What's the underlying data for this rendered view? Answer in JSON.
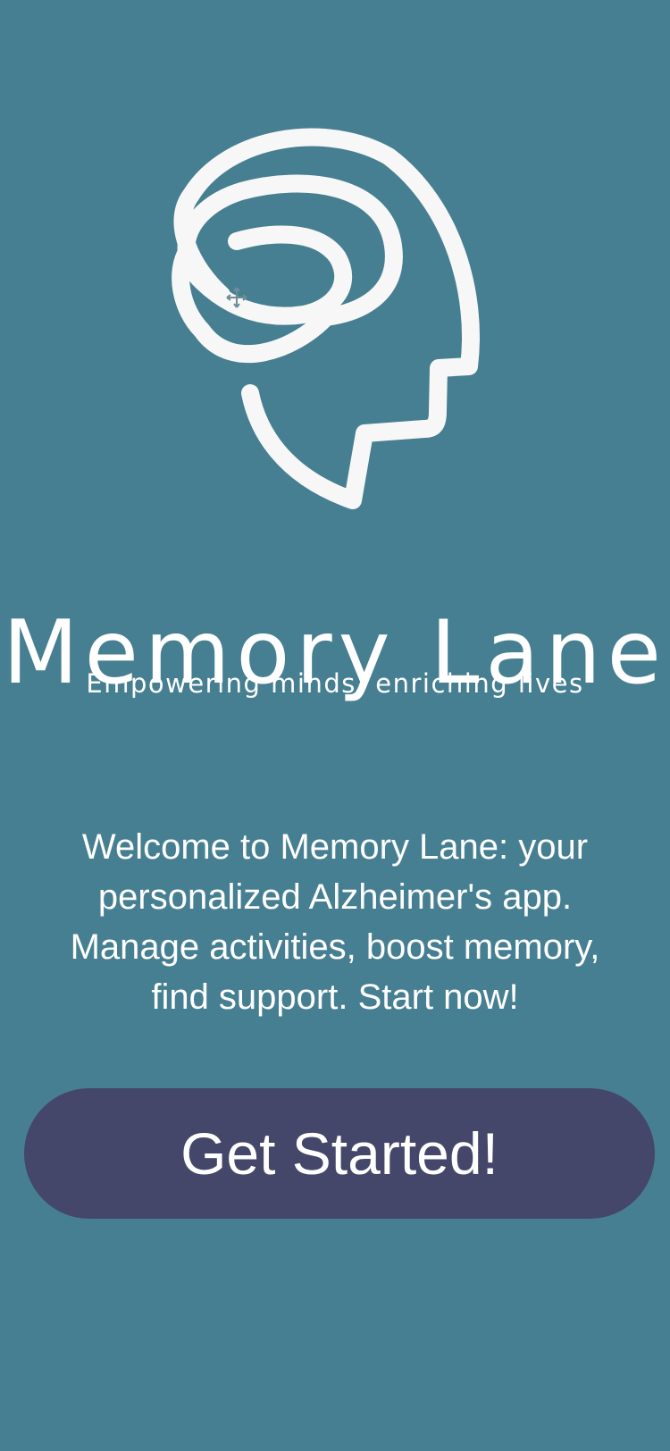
{
  "app": {
    "title": "Memory Lane",
    "tagline": "Empowering minds, enriching lives",
    "welcome_text": "Welcome to Memory Lane: your personalized Alzheimer's app. Manage activities, boost memory, find support. Start now!"
  },
  "actions": {
    "primary_label": "Get Started!"
  },
  "icons": {
    "logo": "head-brain-swirl-icon",
    "cursor": "move-cursor-icon"
  },
  "colors": {
    "background": "#467f91",
    "button": "#44466a",
    "text": "#ffffff"
  }
}
